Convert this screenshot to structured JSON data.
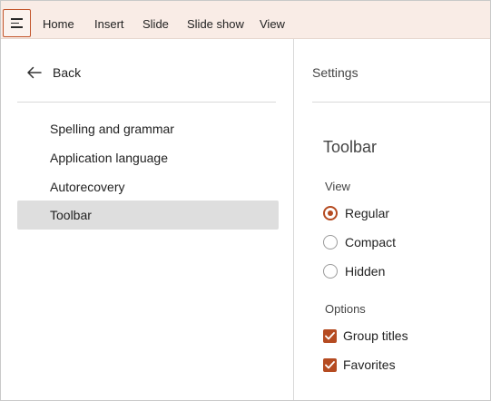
{
  "menubar": {
    "items": [
      "Home",
      "Insert",
      "Slide",
      "Slide show",
      "View"
    ]
  },
  "nav": {
    "back_label": "Back",
    "items": [
      {
        "label": "Spelling and grammar",
        "active": false
      },
      {
        "label": "Application language",
        "active": false
      },
      {
        "label": "Autorecovery",
        "active": false
      },
      {
        "label": "Toolbar",
        "active": true
      }
    ]
  },
  "settings": {
    "header": "Settings",
    "section_title": "Toolbar",
    "view": {
      "label": "View",
      "options": [
        {
          "label": "Regular",
          "checked": true
        },
        {
          "label": "Compact",
          "checked": false
        },
        {
          "label": "Hidden",
          "checked": false
        }
      ]
    },
    "options": {
      "label": "Options",
      "items": [
        {
          "label": "Group titles",
          "checked": true
        },
        {
          "label": "Favorites",
          "checked": true
        }
      ]
    }
  },
  "colors": {
    "accent": "#b54b21",
    "menubar_bg": "#f9ece6",
    "selected_nav_bg": "#dedede"
  },
  "icons": {
    "menu": "hamburger-icon",
    "back": "arrow-left-icon",
    "check": "checkmark-icon"
  }
}
